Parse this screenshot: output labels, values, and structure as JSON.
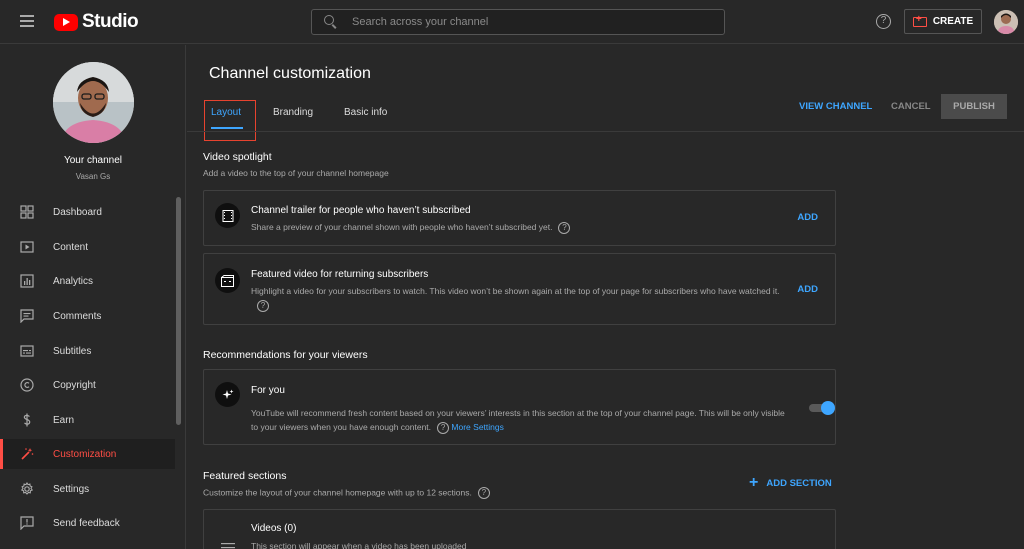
{
  "header": {
    "app_name": "Studio",
    "search_placeholder": "Search across your channel",
    "help_glyph": "?",
    "create_label": "CREATE"
  },
  "sidebar": {
    "channel_title": "Your channel",
    "channel_name": "Vasan Gs",
    "items": [
      {
        "label": "Dashboard",
        "icon": "dashboard-icon"
      },
      {
        "label": "Content",
        "icon": "content-icon"
      },
      {
        "label": "Analytics",
        "icon": "analytics-icon"
      },
      {
        "label": "Comments",
        "icon": "comments-icon"
      },
      {
        "label": "Subtitles",
        "icon": "subtitles-icon"
      },
      {
        "label": "Copyright",
        "icon": "copyright-icon"
      },
      {
        "label": "Earn",
        "icon": "earn-icon"
      },
      {
        "label": "Customization",
        "icon": "customization-icon",
        "active": true
      },
      {
        "label": "Settings",
        "icon": "settings-icon"
      },
      {
        "label": "Send feedback",
        "icon": "feedback-icon"
      }
    ]
  },
  "main": {
    "page_title": "Channel customization",
    "tabs": [
      {
        "label": "Layout",
        "active": true
      },
      {
        "label": "Branding"
      },
      {
        "label": "Basic info"
      }
    ],
    "actions": {
      "view_channel": "VIEW CHANNEL",
      "cancel": "CANCEL",
      "publish": "PUBLISH"
    },
    "video_spotlight": {
      "title": "Video spotlight",
      "description": "Add a video to the top of your channel homepage",
      "trailer": {
        "title": "Channel trailer for people who haven’t subscribed",
        "description": "Share a preview of your channel shown with people who haven’t subscribed yet.",
        "action": "ADD"
      },
      "featured": {
        "title": "Featured video for returning subscribers",
        "description": "Highlight a video for your subscribers to watch. This video won’t be shown again at the top of your page for subscribers who have watched it.",
        "action": "ADD"
      }
    },
    "recommendations": {
      "title": "Recommendations for your viewers",
      "for_you": {
        "title": "For you",
        "description": "YouTube will recommend fresh content based on your viewers’ interests in this section at the top of your channel page. This will be only visible to your viewers when you have enough content.",
        "more_settings": "More Settings",
        "enabled": true
      }
    },
    "featured_sections": {
      "title": "Featured sections",
      "description": "Customize the layout of your channel homepage with up to 12 sections.",
      "add_label": "ADD SECTION",
      "items": [
        {
          "title": "Videos (0)",
          "description": "This section will appear when a video has been uploaded"
        }
      ]
    }
  },
  "colors": {
    "accent_blue": "#3ea6ff",
    "active_red": "#ff4e45",
    "brand_red": "#ff0000",
    "background": "#282828"
  }
}
